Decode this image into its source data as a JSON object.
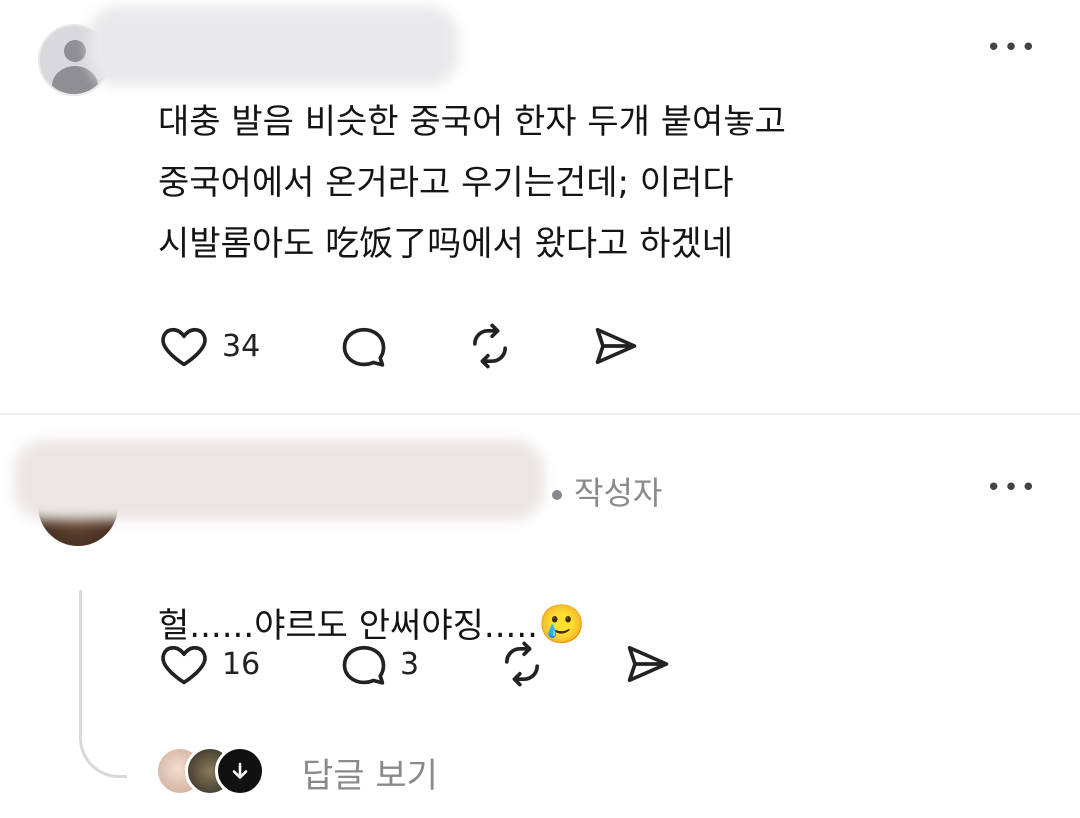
{
  "post1": {
    "text": "대충 발음 비슷한 중국어 한자 두개 붙여놓고\n중국어에서 온거라고 우기는건데; 이러다\n시발롬아도 吃饭了吗에서 왔다고 하겠네",
    "like_count": "34",
    "more_icon": "more-horizontal-icon"
  },
  "post2": {
    "author_badge": "작성자",
    "text": "헐......야르도 안써야징.....",
    "emoji": "🥲",
    "like_count": "16",
    "reply_count": "3",
    "view_replies_label": "답글 보기"
  }
}
